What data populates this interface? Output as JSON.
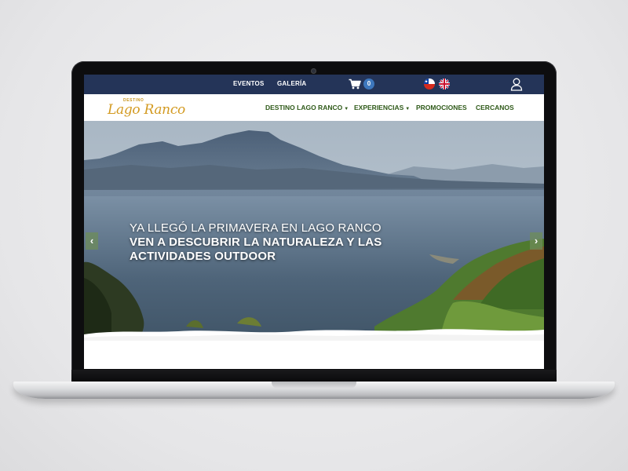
{
  "topbar": {
    "links": [
      "EVENTOS",
      "GALERÍA"
    ],
    "cart_count": "0"
  },
  "logo": {
    "small": "DESTINO",
    "script": "Lago Ranco"
  },
  "nav": {
    "items": [
      "DESTINO LAGO RANCO",
      "EXPERIENCIAS",
      "PROMOCIONES",
      "CERCANOS"
    ]
  },
  "hero": {
    "line1": "YA LLEGÓ LA PRIMAVERA EN LAGO RANCO",
    "line2": "VEN A DESCUBRIR LA NATURALEZA Y LAS",
    "line3": "ACTIVIDADES OUTDOOR",
    "arrow_left": "‹",
    "arrow_right": "›"
  },
  "colors": {
    "topbar": "#243458",
    "nav_text": "#2f5a19",
    "logo": "#d39a21",
    "badge": "#3d77bd"
  }
}
